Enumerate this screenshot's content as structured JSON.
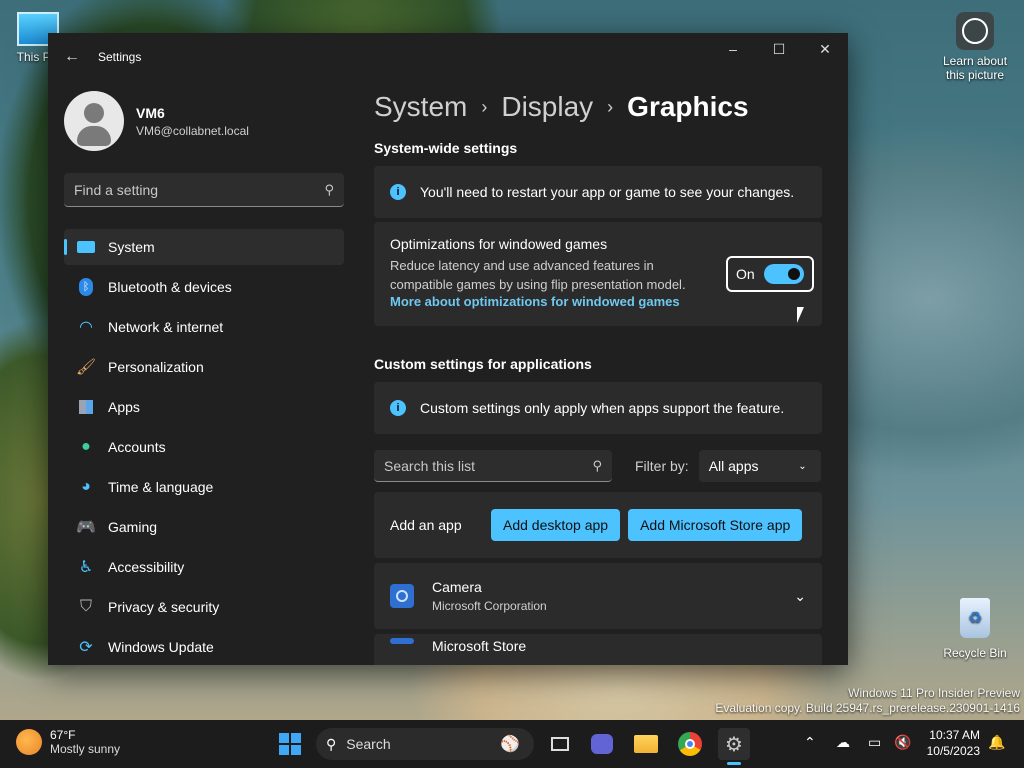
{
  "desktop": {
    "this_pc_label": "This PC",
    "learn_label": "Learn about this picture",
    "recycle_label": "Recycle Bin",
    "watermark_line1": "Windows 11 Pro Insider Preview",
    "watermark_line2": "Evaluation copy. Build 25947.rs_prerelease.230901-1416"
  },
  "window": {
    "title": "Settings",
    "back_icon": "back-arrow-icon",
    "minimize": "–",
    "maximize": "☐",
    "close": "✕"
  },
  "profile": {
    "name": "VM6",
    "email": "VM6@collabnet.local"
  },
  "search": {
    "placeholder": "Find a setting"
  },
  "nav": [
    {
      "label": "System",
      "icon": "monitor-icon",
      "active": true
    },
    {
      "label": "Bluetooth & devices",
      "icon": "bluetooth-icon"
    },
    {
      "label": "Network & internet",
      "icon": "wifi-icon"
    },
    {
      "label": "Personalization",
      "icon": "brush-icon"
    },
    {
      "label": "Apps",
      "icon": "apps-icon"
    },
    {
      "label": "Accounts",
      "icon": "person-icon"
    },
    {
      "label": "Time & language",
      "icon": "globe-clock-icon"
    },
    {
      "label": "Gaming",
      "icon": "gamepad-icon"
    },
    {
      "label": "Accessibility",
      "icon": "accessibility-icon"
    },
    {
      "label": "Privacy & security",
      "icon": "shield-icon"
    },
    {
      "label": "Windows Update",
      "icon": "update-icon"
    }
  ],
  "breadcrumb": {
    "part1": "System",
    "part2": "Display",
    "current": "Graphics",
    "separator": "›"
  },
  "systemwide": {
    "heading": "System-wide settings",
    "info": "You'll need to restart your app or game to see your changes.",
    "opt_title": "Optimizations for windowed games",
    "opt_desc": "Reduce latency and use advanced features in compatible games by using flip presentation model.",
    "opt_link": "More about optimizations for windowed games",
    "toggle_label": "On",
    "toggle_on": true
  },
  "custom": {
    "heading": "Custom settings for applications",
    "info": "Custom settings only apply when apps support the feature.",
    "search_placeholder": "Search this list",
    "filter_label": "Filter by:",
    "filter_value": "All apps",
    "add_label": "Add an app",
    "add_desktop": "Add desktop app",
    "add_store": "Add Microsoft Store app",
    "apps": [
      {
        "name": "Camera",
        "publisher": "Microsoft Corporation"
      },
      {
        "name": "Microsoft Store",
        "publisher": ""
      }
    ]
  },
  "taskbar": {
    "weather_temp": "67°F",
    "weather_desc": "Mostly sunny",
    "search_label": "Search",
    "time": "10:37 AM",
    "date": "10/5/2023"
  },
  "colors": {
    "accent": "#4cc2ff",
    "window_bg": "#202020",
    "card_bg": "#2b2b2b",
    "taskbar_bg": "#1c1c1c"
  }
}
